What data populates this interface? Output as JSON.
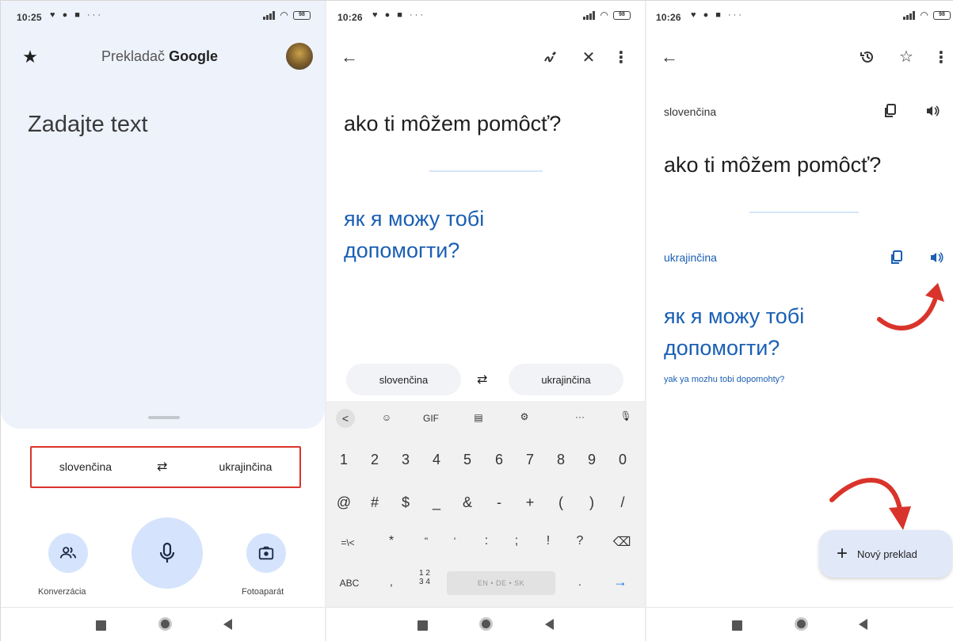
{
  "panel1": {
    "status": {
      "time": "10:25",
      "icons": "♥ ● ■ ···",
      "battery": "98"
    },
    "app_title_prefix": "Prekladač",
    "app_title_brand": "Google",
    "input_placeholder": "Zadajte text",
    "source_language": "slovenčina",
    "target_language": "ukrajinčina",
    "swap_glyph": "⇄",
    "conversation_label": "Konverzácia",
    "camera_label": "Fotoaparát"
  },
  "panel2": {
    "status": {
      "time": "10:26",
      "icons": "♥ ● ■ ···",
      "battery": "98"
    },
    "source_text": "ako ti môžem pomôcť?",
    "translated_line1": "як я можу тобі",
    "translated_line2": "допомогти?",
    "source_language": "slovenčina",
    "target_language": "ukrajinčina",
    "swap_glyph": "⇄",
    "keyboard": {
      "top_row": [
        "<",
        "☺",
        "GIF",
        "▤",
        "⚙",
        "···",
        "🎙"
      ],
      "number_row": [
        "1",
        "2",
        "3",
        "4",
        "5",
        "6",
        "7",
        "8",
        "9",
        "0"
      ],
      "symbol_row": [
        "@",
        "#",
        "$",
        "_",
        "&",
        "-",
        "+",
        "(",
        ")",
        "/"
      ],
      "third_row": [
        "=\\<",
        "*",
        "\"",
        "'",
        ":",
        ";",
        "!",
        "?",
        "⌫"
      ],
      "abc_key": "ABC",
      "comma_key": ",",
      "numpad_key_top": "1 2",
      "numpad_key_bottom": "3 4",
      "space_label": "EN • DE • SK",
      "period_key": ".",
      "enter_key": "→"
    }
  },
  "panel3": {
    "status": {
      "time": "10:26",
      "icons": "♥ ● ■ ···",
      "battery": "98"
    },
    "source_language": "slovenčina",
    "source_text": "ako ti môžem pomôcť?",
    "target_language": "ukrajinčina",
    "translated_line1": "як я можу тобі",
    "translated_line2": "допомогти?",
    "transliteration": "yak ya mozhu tobi dopomohty?",
    "fab_label": "Nový preklad"
  },
  "colors": {
    "accent_blue": "#1a5fb4",
    "highlight_red": "#d9342b",
    "card_bg": "#eef2fb",
    "mic_bg": "#d5e4fc"
  }
}
